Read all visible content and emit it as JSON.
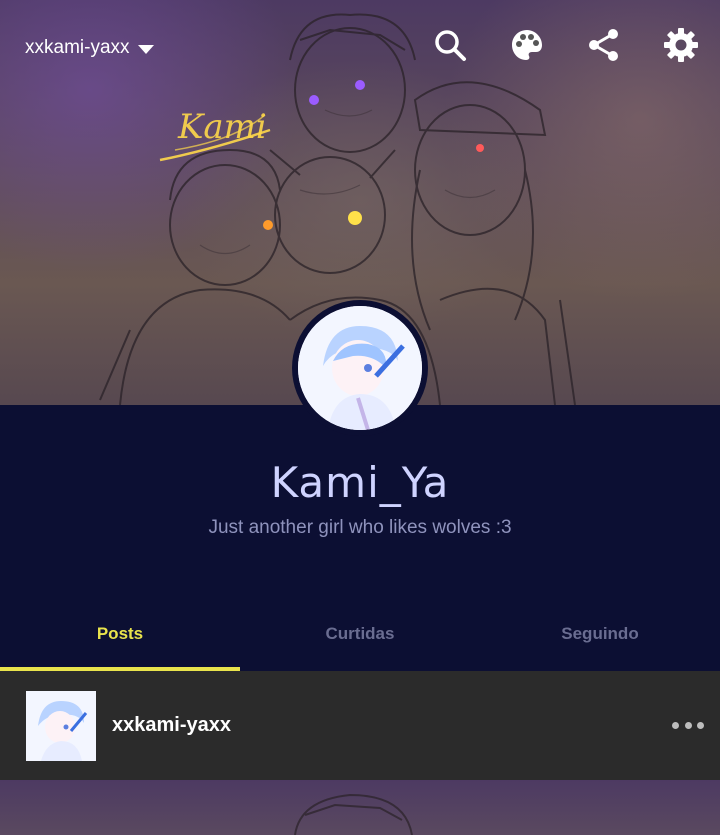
{
  "header": {
    "blog_name": "xxkami-yaxx",
    "icons": [
      "search-icon",
      "palette-icon",
      "share-icon",
      "gear-icon"
    ],
    "banner_signature": "Kami"
  },
  "profile": {
    "title": "Kami_Ya",
    "description": "Just another girl who likes wolves :3"
  },
  "tabs": [
    {
      "label": "Posts",
      "active": true
    },
    {
      "label": "Curtidas",
      "active": false
    },
    {
      "label": "Seguindo",
      "active": false
    }
  ],
  "post": {
    "username": "xxkami-yaxx",
    "menu_icon": "more-dots-icon"
  },
  "colors": {
    "profile_bg": "#0c0f33",
    "title": "#cfd3ff",
    "accent_tab": "#e9e34c",
    "post_row_bg": "#2b2b2b"
  }
}
